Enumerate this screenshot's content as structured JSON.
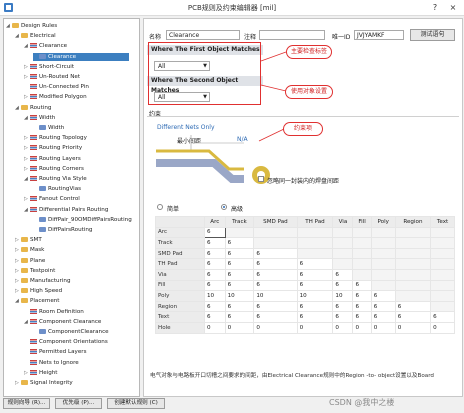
{
  "window": {
    "title": "PCB规则及约束编辑器 [mil]",
    "controls": [
      "?",
      "×"
    ]
  },
  "tree": [
    {
      "label": "Design Rules",
      "level": 0,
      "expander": "◢",
      "icon": "folder"
    },
    {
      "label": "Electrical",
      "level": 1,
      "expander": "◢",
      "icon": "folder"
    },
    {
      "label": "Clearance",
      "level": 2,
      "expander": "◢",
      "icon": "rule"
    },
    {
      "label": "Clearance",
      "level": 3,
      "expander": "",
      "icon": "sub",
      "selected": true
    },
    {
      "label": "Short-Circuit",
      "level": 2,
      "expander": "▷",
      "icon": "rule"
    },
    {
      "label": "Un-Routed Net",
      "level": 2,
      "expander": "▷",
      "icon": "rule"
    },
    {
      "label": "Un-Connected Pin",
      "level": 2,
      "expander": "",
      "icon": "rule"
    },
    {
      "label": "Modified Polygon",
      "level": 2,
      "expander": "▷",
      "icon": "rule"
    },
    {
      "label": "Routing",
      "level": 1,
      "expander": "◢",
      "icon": "folder"
    },
    {
      "label": "Width",
      "level": 2,
      "expander": "◢",
      "icon": "rule"
    },
    {
      "label": "Width",
      "level": 3,
      "expander": "",
      "icon": "sub"
    },
    {
      "label": "Routing Topology",
      "level": 2,
      "expander": "▷",
      "icon": "rule"
    },
    {
      "label": "Routing Priority",
      "level": 2,
      "expander": "▷",
      "icon": "rule"
    },
    {
      "label": "Routing Layers",
      "level": 2,
      "expander": "▷",
      "icon": "rule"
    },
    {
      "label": "Routing Corners",
      "level": 2,
      "expander": "▷",
      "icon": "rule"
    },
    {
      "label": "Routing Via Style",
      "level": 2,
      "expander": "◢",
      "icon": "rule"
    },
    {
      "label": "RoutingVias",
      "level": 3,
      "expander": "",
      "icon": "sub"
    },
    {
      "label": "Fanout Control",
      "level": 2,
      "expander": "▷",
      "icon": "rule"
    },
    {
      "label": "Differential Pairs Routing",
      "level": 2,
      "expander": "◢",
      "icon": "rule"
    },
    {
      "label": "DiffPair_90OMDiffPairsRouting",
      "level": 3,
      "expander": "",
      "icon": "sub"
    },
    {
      "label": "DiffPairsRouting",
      "level": 3,
      "expander": "",
      "icon": "sub"
    },
    {
      "label": "SMT",
      "level": 1,
      "expander": "▷",
      "icon": "folder"
    },
    {
      "label": "Mask",
      "level": 1,
      "expander": "▷",
      "icon": "folder"
    },
    {
      "label": "Plane",
      "level": 1,
      "expander": "▷",
      "icon": "folder"
    },
    {
      "label": "Testpoint",
      "level": 1,
      "expander": "▷",
      "icon": "folder"
    },
    {
      "label": "Manufacturing",
      "level": 1,
      "expander": "▷",
      "icon": "folder"
    },
    {
      "label": "High Speed",
      "level": 1,
      "expander": "▷",
      "icon": "folder"
    },
    {
      "label": "Placement",
      "level": 1,
      "expander": "◢",
      "icon": "folder"
    },
    {
      "label": "Room Definition",
      "level": 2,
      "expander": "",
      "icon": "rule"
    },
    {
      "label": "Component Clearance",
      "level": 2,
      "expander": "◢",
      "icon": "rule"
    },
    {
      "label": "ComponentClearance",
      "level": 3,
      "expander": "",
      "icon": "sub"
    },
    {
      "label": "Component Orientations",
      "level": 2,
      "expander": "",
      "icon": "rule"
    },
    {
      "label": "Permitted Layers",
      "level": 2,
      "expander": "",
      "icon": "rule"
    },
    {
      "label": "Nets to Ignore",
      "level": 2,
      "expander": "",
      "icon": "rule"
    },
    {
      "label": "Height",
      "level": 2,
      "expander": "▷",
      "icon": "rule"
    },
    {
      "label": "Signal Integrity",
      "level": 1,
      "expander": "▷",
      "icon": "folder"
    }
  ],
  "rule": {
    "name_label": "名称",
    "name_value": "Clearance",
    "comment_label": "注释",
    "comment_value": "",
    "uid_label": "唯一ID",
    "uid_value": "JVJYAMKF",
    "test_button": "测试语句"
  },
  "first_match": {
    "header": "Where The First Object Matches",
    "value": "All"
  },
  "second_match": {
    "header": "Where The Second Object Matches",
    "value": "All"
  },
  "callouts": {
    "rule_name": "主要检查标签",
    "object_setting": "使用对象设置",
    "constraint": "约束项"
  },
  "constraints": {
    "header": "约束",
    "diff_nets_only": "Different Nets Only",
    "min_clearance_label": "最小间距",
    "min_clearance_value": "N/A",
    "ignore_pad_label": "忽略同一封装内的焊盘间距",
    "mode_simple": "简单",
    "mode_advanced": "高级"
  },
  "matrix": {
    "columns": [
      "Arc",
      "Track",
      "SMD Pad",
      "TH Pad",
      "Via",
      "Fill",
      "Poly",
      "Region",
      "Text"
    ],
    "rows": [
      {
        "name": "Arc",
        "values": [
          "6"
        ]
      },
      {
        "name": "Track",
        "values": [
          "6",
          "6"
        ]
      },
      {
        "name": "SMD Pad",
        "values": [
          "6",
          "6",
          "6"
        ]
      },
      {
        "name": "TH Pad",
        "values": [
          "6",
          "6",
          "6",
          "6"
        ]
      },
      {
        "name": "Via",
        "values": [
          "6",
          "6",
          "6",
          "6",
          "6"
        ]
      },
      {
        "name": "Fill",
        "values": [
          "6",
          "6",
          "6",
          "6",
          "6",
          "6"
        ]
      },
      {
        "name": "Poly",
        "values": [
          "10",
          "10",
          "10",
          "10",
          "10",
          "6",
          "6"
        ]
      },
      {
        "name": "Region",
        "values": [
          "6",
          "6",
          "6",
          "6",
          "6",
          "6",
          "6",
          "6"
        ]
      },
      {
        "name": "Text",
        "values": [
          "6",
          "6",
          "6",
          "6",
          "6",
          "6",
          "6",
          "6",
          "6"
        ]
      },
      {
        "name": "Hole",
        "values": [
          "0",
          "0",
          "0",
          "0",
          "0",
          "0",
          "0",
          "0",
          "0"
        ]
      }
    ]
  },
  "note": "电气对象与电路板开口切槽之间要求的间距，由Electrical Clearance规则中的Region -to- object设置以及Board",
  "footer": {
    "rule_wizard": "规则向导 (R)...",
    "priority": "优先级 (P)...",
    "create_default": "创建默认规则 (C)"
  },
  "watermark": "CSDN @我中之楼"
}
